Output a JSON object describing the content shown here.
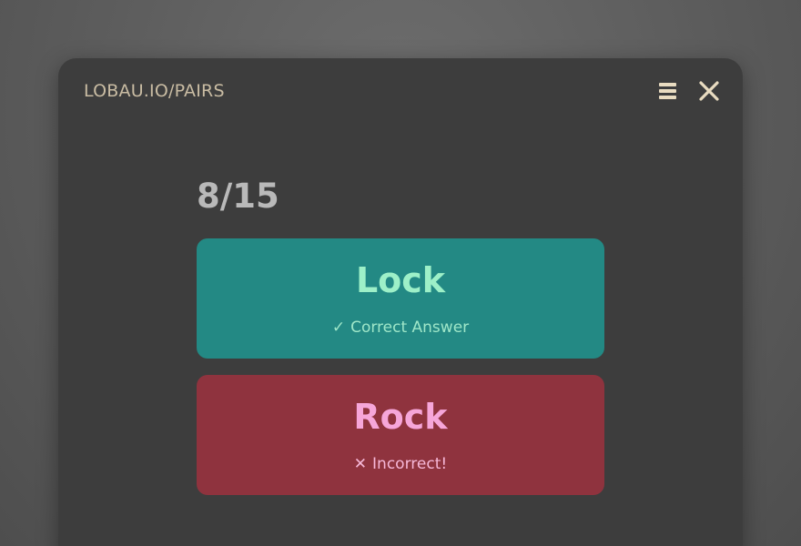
{
  "header": {
    "title": "LOBAU.IO/PAIRS",
    "menu_icon": "hamburger-menu-icon",
    "close_icon": "close-icon"
  },
  "game": {
    "progress": "8/15",
    "answers": [
      {
        "word": "Lock",
        "status_icon": "✓",
        "status_text": "Correct Answer",
        "state": "correct",
        "color": "#238984"
      },
      {
        "word": "Rock",
        "status_icon": "✕",
        "status_text": "Incorrect!",
        "state": "incorrect",
        "color": "#8f333e"
      }
    ]
  }
}
